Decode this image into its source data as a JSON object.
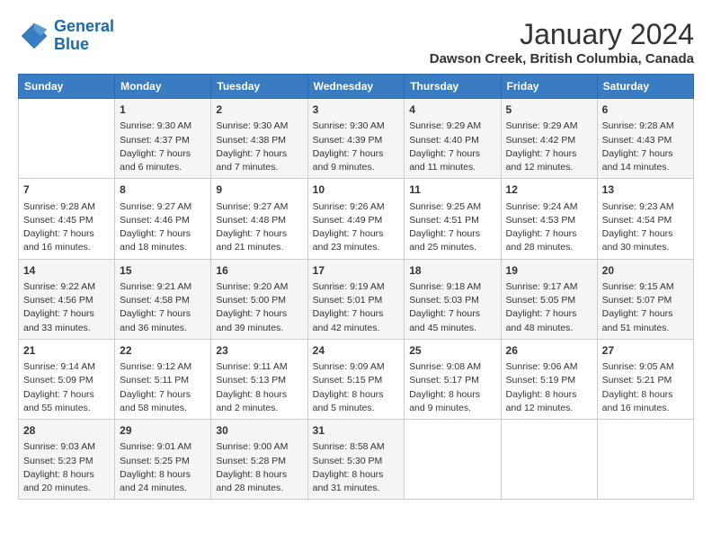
{
  "header": {
    "logo_line1": "General",
    "logo_line2": "Blue",
    "month_year": "January 2024",
    "location": "Dawson Creek, British Columbia, Canada"
  },
  "days_of_week": [
    "Sunday",
    "Monday",
    "Tuesday",
    "Wednesday",
    "Thursday",
    "Friday",
    "Saturday"
  ],
  "weeks": [
    [
      {
        "day": "",
        "sunrise": "",
        "sunset": "",
        "daylight": ""
      },
      {
        "day": "1",
        "sunrise": "Sunrise: 9:30 AM",
        "sunset": "Sunset: 4:37 PM",
        "daylight": "Daylight: 7 hours and 6 minutes."
      },
      {
        "day": "2",
        "sunrise": "Sunrise: 9:30 AM",
        "sunset": "Sunset: 4:38 PM",
        "daylight": "Daylight: 7 hours and 7 minutes."
      },
      {
        "day": "3",
        "sunrise": "Sunrise: 9:30 AM",
        "sunset": "Sunset: 4:39 PM",
        "daylight": "Daylight: 7 hours and 9 minutes."
      },
      {
        "day": "4",
        "sunrise": "Sunrise: 9:29 AM",
        "sunset": "Sunset: 4:40 PM",
        "daylight": "Daylight: 7 hours and 11 minutes."
      },
      {
        "day": "5",
        "sunrise": "Sunrise: 9:29 AM",
        "sunset": "Sunset: 4:42 PM",
        "daylight": "Daylight: 7 hours and 12 minutes."
      },
      {
        "day": "6",
        "sunrise": "Sunrise: 9:28 AM",
        "sunset": "Sunset: 4:43 PM",
        "daylight": "Daylight: 7 hours and 14 minutes."
      }
    ],
    [
      {
        "day": "7",
        "sunrise": "Sunrise: 9:28 AM",
        "sunset": "Sunset: 4:45 PM",
        "daylight": "Daylight: 7 hours and 16 minutes."
      },
      {
        "day": "8",
        "sunrise": "Sunrise: 9:27 AM",
        "sunset": "Sunset: 4:46 PM",
        "daylight": "Daylight: 7 hours and 18 minutes."
      },
      {
        "day": "9",
        "sunrise": "Sunrise: 9:27 AM",
        "sunset": "Sunset: 4:48 PM",
        "daylight": "Daylight: 7 hours and 21 minutes."
      },
      {
        "day": "10",
        "sunrise": "Sunrise: 9:26 AM",
        "sunset": "Sunset: 4:49 PM",
        "daylight": "Daylight: 7 hours and 23 minutes."
      },
      {
        "day": "11",
        "sunrise": "Sunrise: 9:25 AM",
        "sunset": "Sunset: 4:51 PM",
        "daylight": "Daylight: 7 hours and 25 minutes."
      },
      {
        "day": "12",
        "sunrise": "Sunrise: 9:24 AM",
        "sunset": "Sunset: 4:53 PM",
        "daylight": "Daylight: 7 hours and 28 minutes."
      },
      {
        "day": "13",
        "sunrise": "Sunrise: 9:23 AM",
        "sunset": "Sunset: 4:54 PM",
        "daylight": "Daylight: 7 hours and 30 minutes."
      }
    ],
    [
      {
        "day": "14",
        "sunrise": "Sunrise: 9:22 AM",
        "sunset": "Sunset: 4:56 PM",
        "daylight": "Daylight: 7 hours and 33 minutes."
      },
      {
        "day": "15",
        "sunrise": "Sunrise: 9:21 AM",
        "sunset": "Sunset: 4:58 PM",
        "daylight": "Daylight: 7 hours and 36 minutes."
      },
      {
        "day": "16",
        "sunrise": "Sunrise: 9:20 AM",
        "sunset": "Sunset: 5:00 PM",
        "daylight": "Daylight: 7 hours and 39 minutes."
      },
      {
        "day": "17",
        "sunrise": "Sunrise: 9:19 AM",
        "sunset": "Sunset: 5:01 PM",
        "daylight": "Daylight: 7 hours and 42 minutes."
      },
      {
        "day": "18",
        "sunrise": "Sunrise: 9:18 AM",
        "sunset": "Sunset: 5:03 PM",
        "daylight": "Daylight: 7 hours and 45 minutes."
      },
      {
        "day": "19",
        "sunrise": "Sunrise: 9:17 AM",
        "sunset": "Sunset: 5:05 PM",
        "daylight": "Daylight: 7 hours and 48 minutes."
      },
      {
        "day": "20",
        "sunrise": "Sunrise: 9:15 AM",
        "sunset": "Sunset: 5:07 PM",
        "daylight": "Daylight: 7 hours and 51 minutes."
      }
    ],
    [
      {
        "day": "21",
        "sunrise": "Sunrise: 9:14 AM",
        "sunset": "Sunset: 5:09 PM",
        "daylight": "Daylight: 7 hours and 55 minutes."
      },
      {
        "day": "22",
        "sunrise": "Sunrise: 9:12 AM",
        "sunset": "Sunset: 5:11 PM",
        "daylight": "Daylight: 7 hours and 58 minutes."
      },
      {
        "day": "23",
        "sunrise": "Sunrise: 9:11 AM",
        "sunset": "Sunset: 5:13 PM",
        "daylight": "Daylight: 8 hours and 2 minutes."
      },
      {
        "day": "24",
        "sunrise": "Sunrise: 9:09 AM",
        "sunset": "Sunset: 5:15 PM",
        "daylight": "Daylight: 8 hours and 5 minutes."
      },
      {
        "day": "25",
        "sunrise": "Sunrise: 9:08 AM",
        "sunset": "Sunset: 5:17 PM",
        "daylight": "Daylight: 8 hours and 9 minutes."
      },
      {
        "day": "26",
        "sunrise": "Sunrise: 9:06 AM",
        "sunset": "Sunset: 5:19 PM",
        "daylight": "Daylight: 8 hours and 12 minutes."
      },
      {
        "day": "27",
        "sunrise": "Sunrise: 9:05 AM",
        "sunset": "Sunset: 5:21 PM",
        "daylight": "Daylight: 8 hours and 16 minutes."
      }
    ],
    [
      {
        "day": "28",
        "sunrise": "Sunrise: 9:03 AM",
        "sunset": "Sunset: 5:23 PM",
        "daylight": "Daylight: 8 hours and 20 minutes."
      },
      {
        "day": "29",
        "sunrise": "Sunrise: 9:01 AM",
        "sunset": "Sunset: 5:25 PM",
        "daylight": "Daylight: 8 hours and 24 minutes."
      },
      {
        "day": "30",
        "sunrise": "Sunrise: 9:00 AM",
        "sunset": "Sunset: 5:28 PM",
        "daylight": "Daylight: 8 hours and 28 minutes."
      },
      {
        "day": "31",
        "sunrise": "Sunrise: 8:58 AM",
        "sunset": "Sunset: 5:30 PM",
        "daylight": "Daylight: 8 hours and 31 minutes."
      },
      {
        "day": "",
        "sunrise": "",
        "sunset": "",
        "daylight": ""
      },
      {
        "day": "",
        "sunrise": "",
        "sunset": "",
        "daylight": ""
      },
      {
        "day": "",
        "sunrise": "",
        "sunset": "",
        "daylight": ""
      }
    ]
  ]
}
